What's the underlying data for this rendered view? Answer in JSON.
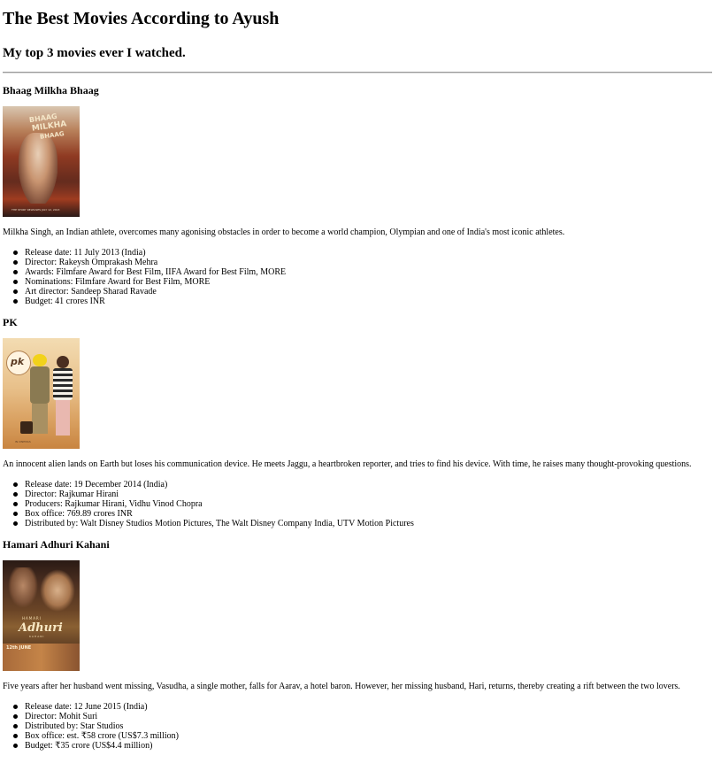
{
  "page": {
    "title": "The Best Movies According to Ayush",
    "subtitle": "My top 3 movies ever I watched."
  },
  "movies": [
    {
      "title": "Bhaag Milkha Bhaag",
      "poster": {
        "alt": "Bhaag Milkha Bhaag poster",
        "line1": "BHAAG",
        "line2": "MILKHA",
        "line3": "BHAAG",
        "footer": "THE STORY RELEASES JULY 12, 2013"
      },
      "description": "Milkha Singh, an Indian athlete, overcomes many agonising obstacles in order to become a world champion, Olympian and one of India's most iconic athletes.",
      "facts": [
        "Release date: 11 July 2013 (India)",
        "Director: Rakeysh Omprakash Mehra",
        "Awards: Filmfare Award for Best Film, IIFA Award for Best Film, MORE",
        "Nominations: Filmfare Award for Best Film, MORE",
        "Art director: Sandeep Sharad Ravade",
        "Budget: 41 crores INR"
      ]
    },
    {
      "title": "PK",
      "poster": {
        "alt": "PK poster",
        "logo": "pk",
        "footer": "IN CINEMAS"
      },
      "description": "An innocent alien lands on Earth but loses his communication device. He meets Jaggu, a heartbroken reporter, and tries to find his device. With time, he raises many thought-provoking questions.",
      "facts": [
        "Release date: 19 December 2014 (India)",
        "Director: Rajkumar Hirani",
        "Producers: Rajkumar Hirani, Vidhu Vinod Chopra",
        "Box office: 769.89 crores INR",
        "Distributed by: Walt Disney Studios Motion Pictures, The Walt Disney Company India, UTV Motion Pictures"
      ]
    },
    {
      "title": "Hamari Adhuri Kahani",
      "poster": {
        "alt": "Hamari Adhuri Kahani poster",
        "line1": "HAMARI",
        "line2": "Adhuri",
        "line3": "KAHANI",
        "date": "12th JUNE"
      },
      "description": "Five years after her husband went missing, Vasudha, a single mother, falls for Aarav, a hotel baron. However, her missing husband, Hari, returns, thereby creating a rift between the two lovers.",
      "facts": [
        "Release date: 12 June 2015 (India)",
        "Director: Mohit Suri",
        "Distributed by: Star Studios",
        "Box office: est. ₹58 crore (US$7.3 million)",
        "Budget: ₹35 crore (US$4.4 million)"
      ]
    }
  ]
}
